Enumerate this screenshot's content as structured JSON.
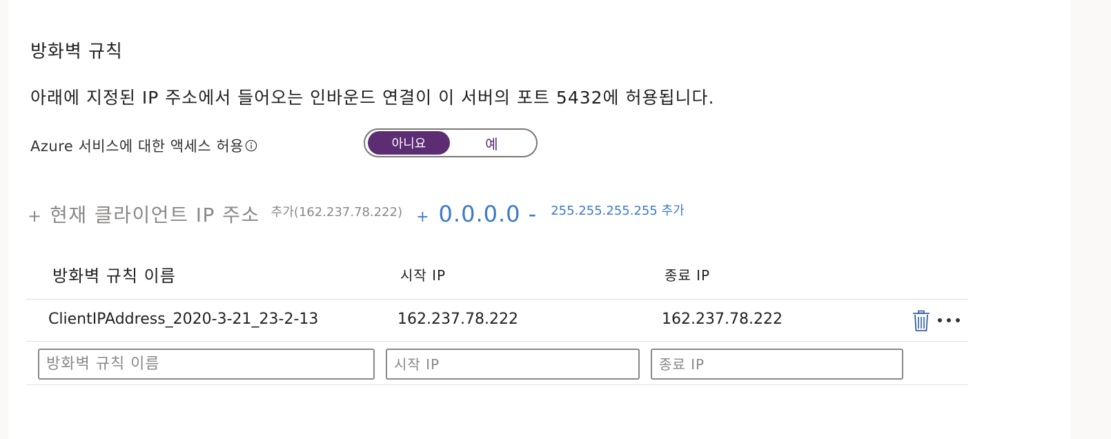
{
  "section_title": "방화벽 규칙",
  "description": "아래에 지정된 IP 주소에서 들어오는 인바운드 연결이 이 서버의 포트 5432에 허용됩니다.",
  "azure_access": {
    "label": "Azure 서비스에 대한 액세스 허용",
    "info_icon": "info-icon",
    "toggle_options": [
      "아니요",
      "예"
    ],
    "selected": "아니요"
  },
  "add_actions": {
    "current_client": {
      "plus": "+",
      "main": "현재 클라이언트 IP 주소",
      "sub": "추가(162.237.78.222)"
    },
    "range": {
      "plus": "+",
      "main": "0.0.0.0 -",
      "sub": "255.255.255.255 추가"
    }
  },
  "table": {
    "columns": [
      "방화벽 규칙 이름",
      "시작 IP",
      "종료 IP"
    ],
    "rows": [
      {
        "name": "ClientIPAddress_2020-3-21_23-2-13",
        "start_ip": "162.237.78.222",
        "end_ip": "162.237.78.222"
      }
    ],
    "new_row_placeholders": {
      "name": "방화벽 규칙 이름",
      "start_ip": "시작 IP",
      "end_ip": "종료 IP"
    }
  },
  "colors": {
    "toggle_selected": "#5c2d73",
    "link_blue": "#3b78c9",
    "muted_gray": "#8a8886",
    "icon_blue": "#2f5f9e"
  }
}
